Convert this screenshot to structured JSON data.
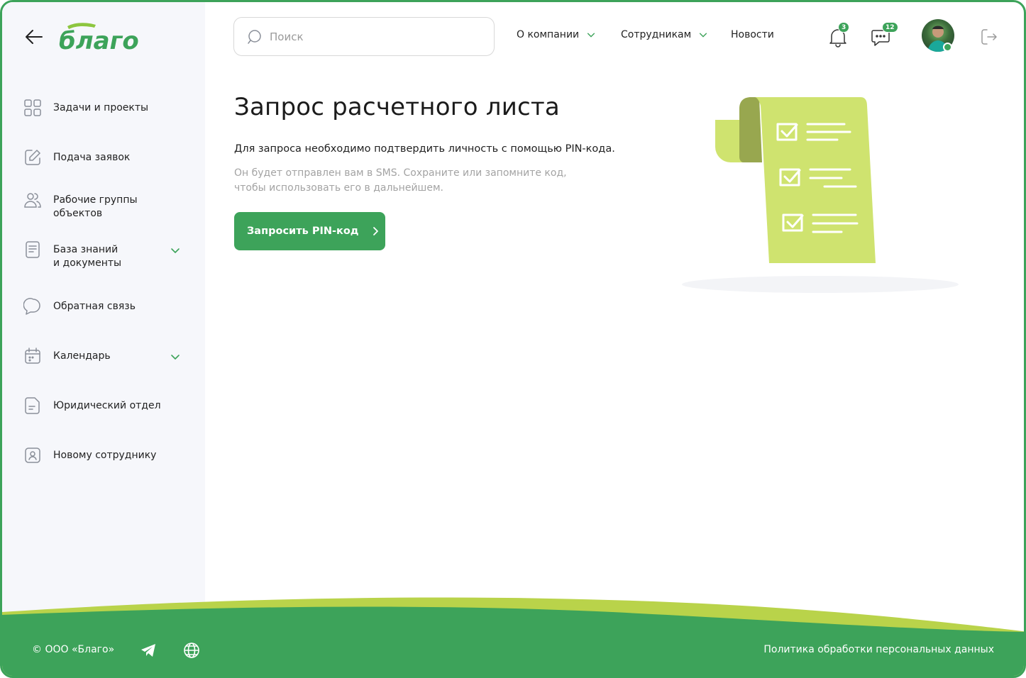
{
  "brand": {
    "name": "благо",
    "accent": "#3da35a",
    "light_accent": "#cfe36f"
  },
  "sidebar": {
    "items": [
      {
        "label": "Задачи и проекты",
        "icon": "grid-icon",
        "has_chevron": false
      },
      {
        "label": "Подача заявок",
        "icon": "edit-icon",
        "has_chevron": false
      },
      {
        "label": "Рабочие группы\nобъектов",
        "icon": "users-icon",
        "has_chevron": false
      },
      {
        "label": "База знаний\nи документы",
        "icon": "book-icon",
        "has_chevron": true
      },
      {
        "label": "Обратная связь",
        "icon": "chat-bubble-icon",
        "has_chevron": false
      },
      {
        "label": "Календарь",
        "icon": "calendar-icon",
        "has_chevron": true
      },
      {
        "label": "Юридический отдел",
        "icon": "document-icon",
        "has_chevron": false
      },
      {
        "label": "Новому сотруднику",
        "icon": "badge-icon",
        "has_chevron": false
      }
    ]
  },
  "header": {
    "search_placeholder": "Поиск",
    "nav": [
      {
        "label": "О компании",
        "has_chevron": true
      },
      {
        "label": "Сотрудникам",
        "has_chevron": true
      },
      {
        "label": "Новости",
        "has_chevron": false
      }
    ],
    "notifications_count": "3",
    "messages_count": "12"
  },
  "main": {
    "title": "Запрос расчетного листа",
    "description": "Для запроса необходимо подтвердить личность с помощью PIN-кода.",
    "subdescription": "Он будет отправлен вам в SMS. Сохраните или запомните код, чтобы использовать его в дальнейшем.",
    "button_label": "Запросить PIN-код"
  },
  "footer": {
    "copyright": "© ООО «Благо»",
    "policy_link": "Политика обработки персональных данных"
  }
}
